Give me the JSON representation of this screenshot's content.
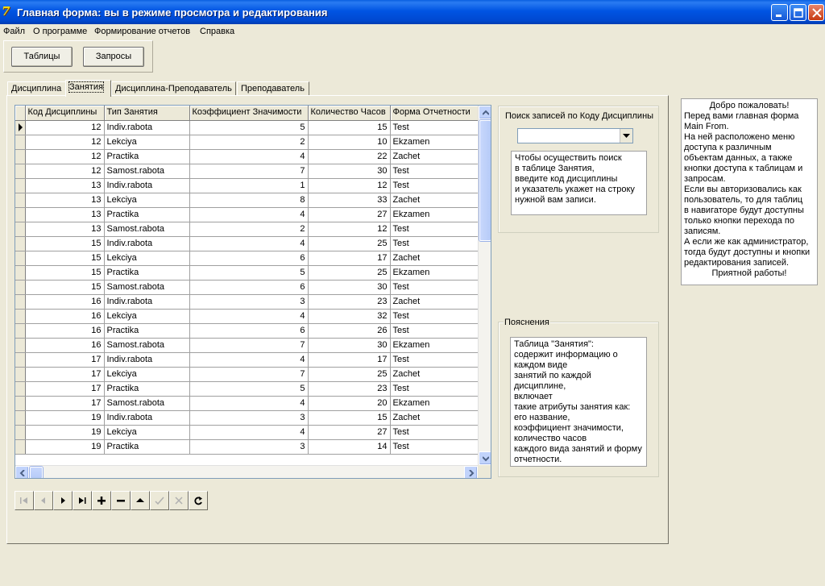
{
  "window": {
    "title": "Главная форма: вы в режиме просмотра и редактирования",
    "app_icon": "7"
  },
  "menu": [
    "Файл",
    "О программе",
    "Формирование отчетов",
    "Справка"
  ],
  "buttons": {
    "tables": "Таблицы",
    "queries": "Запросы"
  },
  "tabs": [
    "Дисциплина",
    "Занятия",
    "Дисциплина-Преподаватель",
    "Преподаватель"
  ],
  "grid": {
    "columns": [
      "Код Дисциплины",
      "Тип Занятия",
      "Коэффициент Значимости",
      "Количество Часов",
      "Форма Отчетности"
    ],
    "rows": [
      [
        "12",
        "Indiv.rabota",
        "5",
        "15",
        "Test"
      ],
      [
        "12",
        "Lekciya",
        "2",
        "10",
        "Ekzamen"
      ],
      [
        "12",
        "Practika",
        "4",
        "22",
        "Zachet"
      ],
      [
        "12",
        "Samost.rabota",
        "7",
        "30",
        "Test"
      ],
      [
        "13",
        "Indiv.rabota",
        "1",
        "12",
        "Test"
      ],
      [
        "13",
        "Lekciya",
        "8",
        "33",
        "Zachet"
      ],
      [
        "13",
        "Practika",
        "4",
        "27",
        "Ekzamen"
      ],
      [
        "13",
        "Samost.rabota",
        "2",
        "12",
        "Test"
      ],
      [
        "15",
        "Indiv.rabota",
        "4",
        "25",
        "Test"
      ],
      [
        "15",
        "Lekciya",
        "6",
        "17",
        "Zachet"
      ],
      [
        "15",
        "Practika",
        "5",
        "25",
        "Ekzamen"
      ],
      [
        "15",
        "Samost.rabota",
        "6",
        "30",
        "Test"
      ],
      [
        "16",
        "Indiv.rabota",
        "3",
        "23",
        "Zachet"
      ],
      [
        "16",
        "Lekciya",
        "4",
        "32",
        "Test"
      ],
      [
        "16",
        "Practika",
        "6",
        "26",
        "Test"
      ],
      [
        "16",
        "Samost.rabota",
        "7",
        "30",
        "Ekzamen"
      ],
      [
        "17",
        "Indiv.rabota",
        "4",
        "17",
        "Test"
      ],
      [
        "17",
        "Lekciya",
        "7",
        "25",
        "Zachet"
      ],
      [
        "17",
        "Practika",
        "5",
        "23",
        "Test"
      ],
      [
        "17",
        "Samost.rabota",
        "4",
        "20",
        "Ekzamen"
      ],
      [
        "19",
        "Indiv.rabota",
        "3",
        "15",
        "Zachet"
      ],
      [
        "19",
        "Lekciya",
        "4",
        "27",
        "Test"
      ],
      [
        "19",
        "Practika",
        "3",
        "14",
        "Test"
      ]
    ]
  },
  "navigator": [
    "first-icon",
    "prior-icon",
    "next-icon",
    "last-icon",
    "insert-icon",
    "delete-icon",
    "edit-icon",
    "post-icon",
    "cancel-icon",
    "refresh-icon"
  ],
  "search": {
    "title": "Поиск записей по Коду Дисциплины",
    "hint": "Чтобы осуществить поиск\nв таблице Занятия,\nвведите код дисциплины\nи указатель укажет на строку\nнужной вам записи."
  },
  "explain": {
    "title": "Пояснения",
    "text": "Таблица \"Занятия\":\nсодержит информацию о\nкаждом виде\nзанятий по каждой дисциплине,\nвключает\nтакие атрибуты занятия как:\nего название,\nкоэффициент значимости,\nколичество часов\nкаждого вида занятий и форму\nотчетности."
  },
  "welcome": {
    "greeting": "Добро пожаловать!",
    "lines": [
      "Перед вами главная форма",
      "Main From.",
      "На ней расположено меню",
      "доступа к различным",
      "объектам данных, а также",
      "кнопки доступа к таблицам и",
      "запросам.",
      "Если вы авторизовались как",
      "пользователь, то для таблиц",
      "в навигаторе будут доступны",
      "только кнопки перехода по",
      "записям.",
      "А если же как администратор,",
      "тогда будут доступны и кнопки",
      "редактирования записей."
    ],
    "closing": "Приятной работы!"
  }
}
